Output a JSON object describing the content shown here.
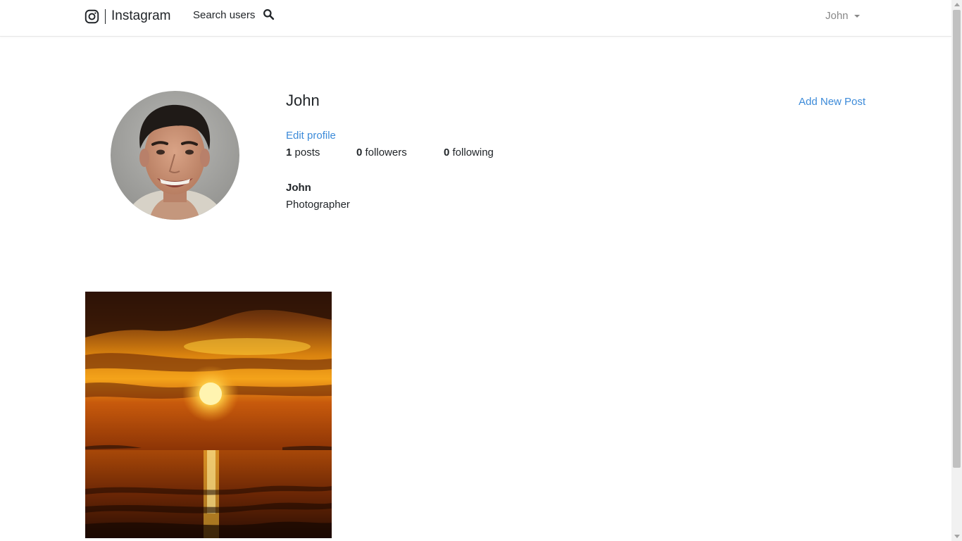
{
  "navbar": {
    "brand": {
      "icon": "instagram-icon",
      "text": "Instagram"
    },
    "search": {
      "label": "Search users",
      "icon": "search-icon"
    },
    "user_menu": {
      "label": "John",
      "icon": "caret-down-icon"
    }
  },
  "profile": {
    "username": "John",
    "add_post_label": "Add New Post",
    "edit_profile_label": "Edit profile",
    "stats": {
      "posts": {
        "count": "1",
        "label": "posts"
      },
      "followers": {
        "count": "0",
        "label": "followers"
      },
      "following": {
        "count": "0",
        "label": "following"
      }
    },
    "bio": {
      "name": "John",
      "description": "Photographer"
    }
  },
  "posts": [
    {
      "image": "sunset-over-sea-photo"
    }
  ],
  "colors": {
    "link": "#3d8bd9",
    "text": "#212529",
    "muted": "#888888"
  }
}
